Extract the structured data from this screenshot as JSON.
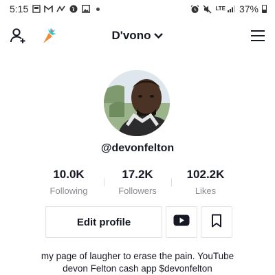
{
  "status_bar": {
    "time": "5:15",
    "network": "LTE",
    "battery_percent": "37%",
    "battery_level": 0.37,
    "left_icons": [
      "gallery-icon",
      "gmail-icon",
      "notification-icon",
      "shazam-icon",
      "image-icon",
      "dot-icon"
    ],
    "right_icons": [
      "alarm-icon",
      "mute-icon",
      "signal-icon",
      "battery-icon"
    ]
  },
  "nav": {
    "title": "D'vono",
    "left_icons": [
      "add-friend-icon",
      "carrot-icon"
    ],
    "right_icon": "menu-icon"
  },
  "profile": {
    "username": "@devonfelton",
    "stats": [
      {
        "value": "10.0K",
        "label": "Following"
      },
      {
        "value": "17.2K",
        "label": "Followers"
      },
      {
        "value": "102.2K",
        "label": "Likes"
      }
    ],
    "edit_label": "Edit profile",
    "bio_lines": [
      "my page of laugher to erase the pain. YouTube",
      "devon Felton cash app $devonfelton"
    ]
  },
  "colors": {
    "text": "#161823",
    "muted": "#8a8b91",
    "border": "#e1e1e3"
  }
}
